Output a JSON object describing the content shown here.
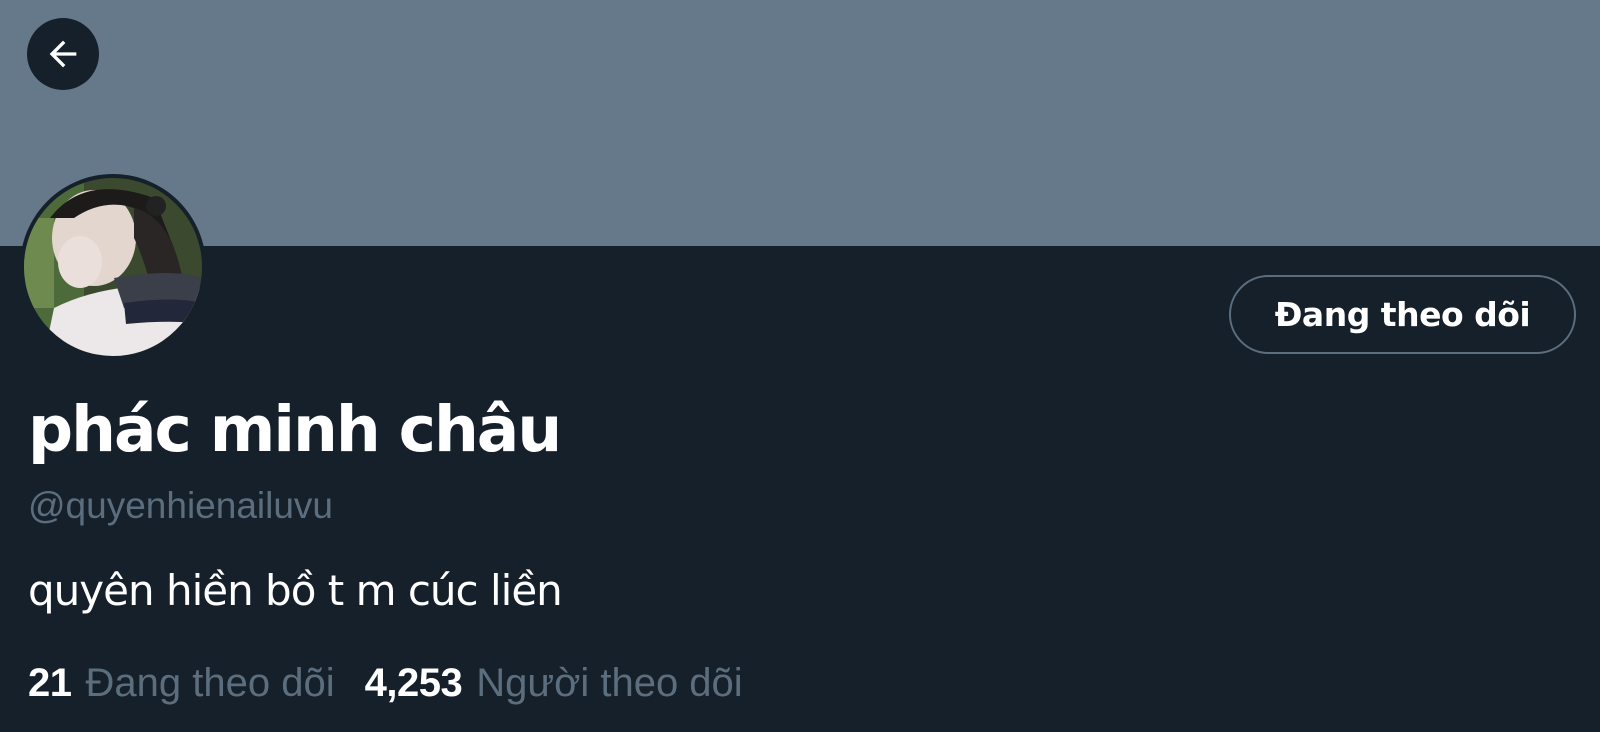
{
  "profile": {
    "display_name": "phác minh châu",
    "handle": "@quyenhienailuvu",
    "bio": "quyên hiền bồ t m cúc liền",
    "follow_button_label": "Đang theo dõi"
  },
  "stats": {
    "following_count": "21",
    "following_label": "Đang theo dõi",
    "followers_count": "4,253",
    "followers_label": "Người theo dõi"
  },
  "icons": {
    "back": "arrow-left-icon",
    "avatar": "profile-photo"
  },
  "colors": {
    "background": "#15202b",
    "banner": "#66798b",
    "secondary_text": "#5c6e7e",
    "primary_text": "#ffffff",
    "button_border": "#5c6e7e"
  }
}
